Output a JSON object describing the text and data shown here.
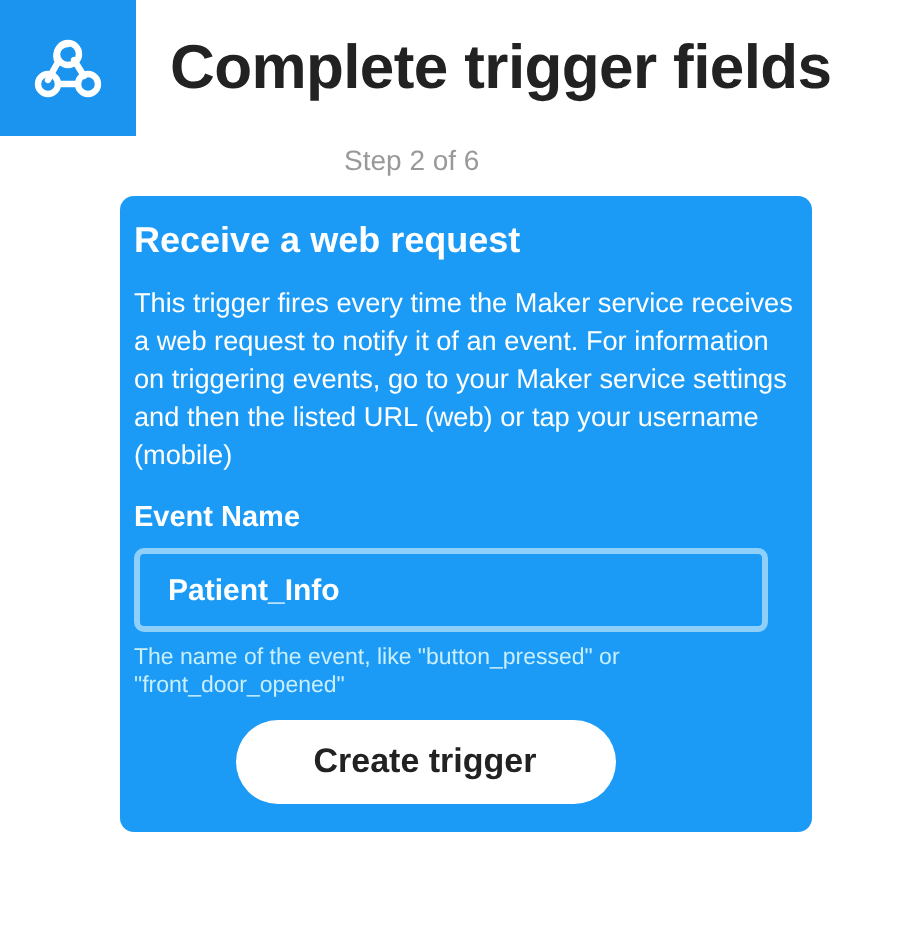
{
  "header": {
    "title": "Complete trigger fields",
    "step": "Step 2 of 6"
  },
  "card": {
    "title": "Receive a web request",
    "description": "This trigger fires every time the Maker service receives a web request to notify it of an event. For information on triggering events, go to your Maker service settings and then the listed URL (web) or tap your username (mobile)",
    "field": {
      "label": "Event Name",
      "value": "Patient_Info",
      "help": "The name of the event, like \"button_pressed\" or \"front_door_opened\""
    },
    "button": "Create trigger"
  }
}
